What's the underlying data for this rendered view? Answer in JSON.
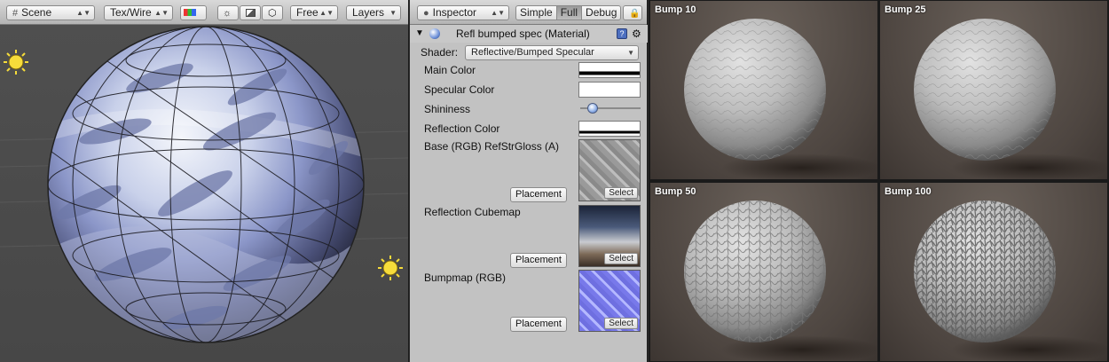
{
  "scene": {
    "menus": {
      "scene": "Scene",
      "draw_mode": "Tex/Wire",
      "render_mode": "RGB",
      "camera": "Free",
      "layers": "Layers"
    },
    "icons": [
      "grid-icon",
      "rgb-icon",
      "sun-icon",
      "image-icon",
      "cube-icon",
      "light-icon"
    ]
  },
  "inspector": {
    "tab": "Inspector",
    "modes": [
      "Simple",
      "Full",
      "Debug"
    ],
    "active_mode": "Full",
    "material_title": "Refl bumped spec (Material)",
    "shader_label": "Shader:",
    "shader_value": "Reflective/Bumped Specular",
    "properties": {
      "main_color": "Main Color",
      "specular_color": "Specular Color",
      "shininess": "Shininess",
      "shininess_value": 0.15,
      "reflection_color": "Reflection Color",
      "base": "Base (RGB) RefStrGloss (A)",
      "cubemap": "Reflection Cubemap",
      "bumpmap": "Bumpmap (RGB)"
    },
    "placement_label": "Placement",
    "select_label": "Select",
    "colors": {
      "panel_bg": "#c2c2c2",
      "bump_tex": "#8b8cf4"
    }
  },
  "bump_grid": [
    {
      "label": "Bump 10"
    },
    {
      "label": "Bump 25"
    },
    {
      "label": "Bump 50"
    },
    {
      "label": "Bump 100"
    }
  ]
}
